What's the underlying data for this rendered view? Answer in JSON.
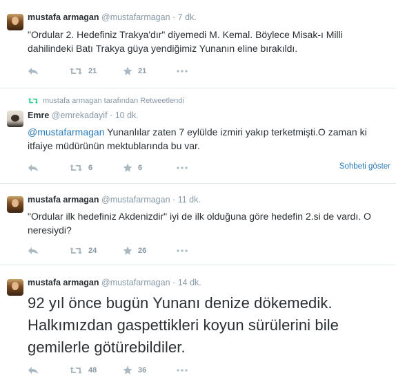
{
  "tweets": [
    {
      "name": "mustafa armagan",
      "handle": "@mustafarmagan",
      "time": "7 dk.",
      "text": "\"Ordular 2. Hedefiniz Trakya'dır\" diyemedi M. Kemal. Böylece Misak-ı Milli dahilindeki Batı Trakya güya yendiğimiz Yunanın eline bırakıldı.",
      "retweets": "21",
      "favorites": "21"
    },
    {
      "retweeted_by": "mustafa armagan tarafından Retweetlendi",
      "name": "Emre",
      "handle": "@emrekadayif",
      "time": "10 dk.",
      "mention": "@mustafarmagan",
      "text": " Yunanlılar zaten 7 eylülde izmiri yakıp terketmişti.O zaman ki itfaiye müdürünün mektublarında bu var.",
      "retweets": "6",
      "favorites": "6",
      "conversation_link": "Sohbeti göster"
    },
    {
      "name": "mustafa armagan",
      "handle": "@mustafarmagan",
      "time": "11 dk.",
      "text": "\"Ordular ilk hedefiniz Akdenizdir\" iyi de ilk olduğuna göre hedefin 2.si de vardı. O neresiydi?",
      "retweets": "24",
      "favorites": "26"
    },
    {
      "name": "mustafa armagan",
      "handle": "@mustafarmagan",
      "time": "14 dk.",
      "text": "92 yıl önce bugün Yunanı denize dökemedik. Halkımızdan gaspettikleri koyun sürülerini bile gemilerle götürebildiler.",
      "retweets": "48",
      "favorites": "36"
    }
  ],
  "separator": "·",
  "colors": {
    "text": "#292f33",
    "muted": "#8899a6",
    "link": "#2b7bb9",
    "border": "#e1e8ed"
  }
}
